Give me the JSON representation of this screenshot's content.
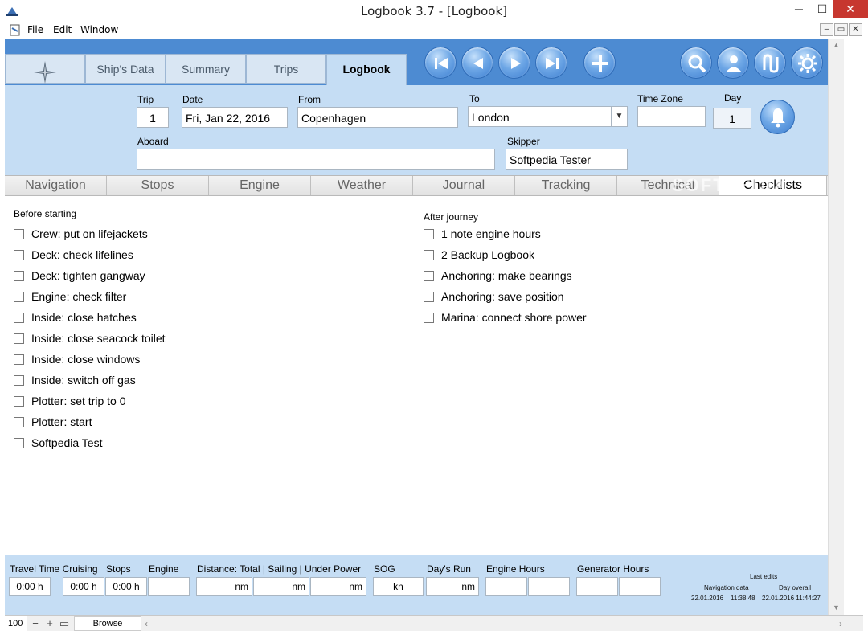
{
  "window": {
    "title": "Logbook 3.7 - [Logbook]",
    "min_icon": "─",
    "max_icon": "☐",
    "close_icon": "✕"
  },
  "menu": {
    "items": [
      "File",
      "Edit",
      "Window"
    ],
    "mdi_min": "–",
    "mdi_restore": "▭",
    "mdi_close": "✕"
  },
  "main_tabs": [
    "Ship's Data",
    "Summary",
    "Trips",
    "Logbook"
  ],
  "active_main_tab": "Logbook",
  "nav_icons": [
    "first-record-icon",
    "previous-record-icon",
    "next-record-icon",
    "last-record-icon",
    "add-record-icon",
    "search-icon",
    "user-icon",
    "route-icon",
    "settings-icon"
  ],
  "form": {
    "trip_label": "Trip",
    "trip_value": "1",
    "date_label": "Date",
    "date_value": "Fri, Jan 22, 2016",
    "from_label": "From",
    "from_value": "Copenhagen",
    "to_label": "To",
    "to_value": "London",
    "timezone_label": "Time Zone",
    "timezone_value": "",
    "day_label": "Day",
    "day_value": "1",
    "aboard_label": "Aboard",
    "aboard_value": "",
    "skipper_label": "Skipper",
    "skipper_value": "Softpedia Tester"
  },
  "sub_tabs": [
    "Navigation",
    "Stops",
    "Engine",
    "Weather",
    "Journal",
    "Tracking",
    "Technical",
    "Checklists"
  ],
  "active_sub_tab": "Checklists",
  "watermark": "SOFTPEDIA",
  "checklists": {
    "before_title": "Before starting",
    "before_items": [
      "Crew: put on lifejackets",
      "Deck: check lifelines",
      "Deck: tighten gangway",
      "Engine: check filter",
      "Inside: close hatches",
      "Inside: close seacock toilet",
      "Inside: close windows",
      "Inside: switch off gas",
      "Plotter: set trip to 0",
      "Plotter: start",
      "Softpedia Test"
    ],
    "after_title": "After journey",
    "after_items": [
      "1 note engine hours",
      "2 Backup Logbook",
      "Anchoring: make bearings",
      "Anchoring: save position",
      "Marina: connect shore power"
    ]
  },
  "stats": {
    "travel_time_label": "Travel Time Cruising",
    "travel_time_value": "0:00 h",
    "cruising_value": "0:00 h",
    "stops_label": "Stops",
    "stops_value": "0:00 h",
    "engine_label": "Engine",
    "engine_value": "",
    "distance_label": "Distance: Total | Sailing | Under Power",
    "distance_total": "nm",
    "distance_sailing": "nm",
    "distance_power": "nm",
    "sog_label": "SOG",
    "sog_value": "kn",
    "days_run_label": "Day's Run",
    "days_run_value": "nm",
    "engine_hours_label": "Engine Hours",
    "generator_hours_label": "Generator Hours",
    "last_edits_label": "Last edits",
    "nav_data_label": "Navigation data",
    "day_overall_label": "Day overall",
    "nav_data_date": "22.01.2016",
    "nav_data_time": "11:38:48",
    "day_overall_datetime": "22.01.2016 11:44:27"
  },
  "status": {
    "zoom": "100",
    "zoom_out": "−",
    "zoom_in": "+",
    "mode": "Browse"
  }
}
